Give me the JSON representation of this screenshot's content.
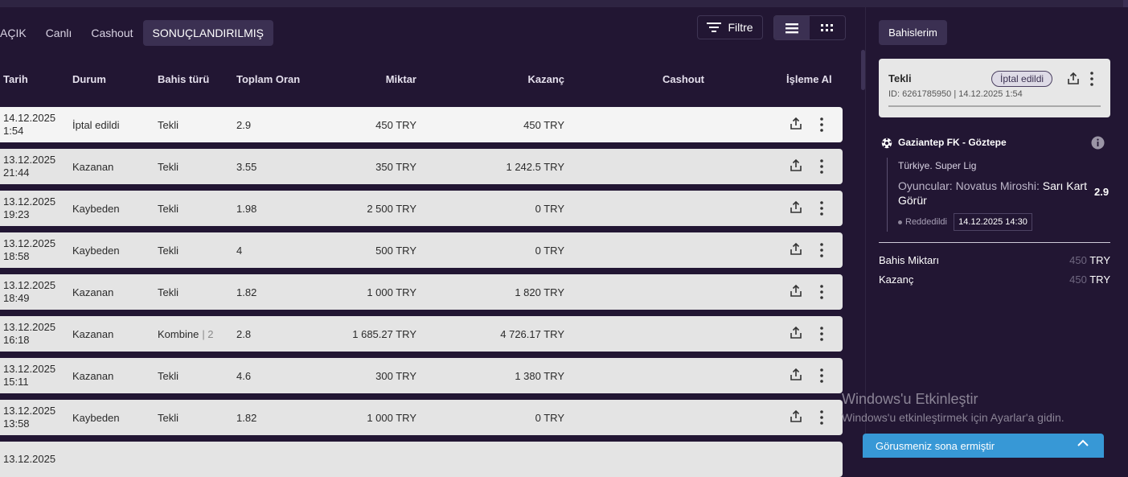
{
  "tabs": [
    {
      "label": "AÇIK"
    },
    {
      "label": "Canlı"
    },
    {
      "label": "Cashout"
    },
    {
      "label": "SONUÇLANDIRILMIŞ"
    }
  ],
  "toolbar": {
    "filter_label": "Filtre",
    "filter_icon": "filter-icon",
    "list_view_icon": "list-view-icon",
    "grid_view_icon": "grid-view-icon"
  },
  "columns": {
    "date": "Tarih",
    "status": "Durum",
    "type": "Bahis türü",
    "odds": "Toplam Oran",
    "amount": "Miktar",
    "win": "Kazanç",
    "cashout": "Cashout",
    "action": "İşleme Al"
  },
  "rows": [
    {
      "date": "14.12.2025",
      "time": "1:54",
      "status": "İptal edildi",
      "type": "Tekli",
      "count": "",
      "odds": "2.9",
      "amount": "450 TRY",
      "win": "450 TRY"
    },
    {
      "date": "13.12.2025",
      "time": "21:44",
      "status": "Kazanan",
      "type": "Tekli",
      "count": "",
      "odds": "3.55",
      "amount": "350 TRY",
      "win": "1 242.5 TRY"
    },
    {
      "date": "13.12.2025",
      "time": "19:23",
      "status": "Kaybeden",
      "type": "Tekli",
      "count": "",
      "odds": "1.98",
      "amount": "2 500 TRY",
      "win": "0 TRY"
    },
    {
      "date": "13.12.2025",
      "time": "18:58",
      "status": "Kaybeden",
      "type": "Tekli",
      "count": "",
      "odds": "4",
      "amount": "500 TRY",
      "win": "0 TRY"
    },
    {
      "date": "13.12.2025",
      "time": "18:49",
      "status": "Kazanan",
      "type": "Tekli",
      "count": "",
      "odds": "1.82",
      "amount": "1 000 TRY",
      "win": "1 820 TRY"
    },
    {
      "date": "13.12.2025",
      "time": "16:18",
      "status": "Kazanan",
      "type": "Kombine",
      "count": "| 2",
      "odds": "2.8",
      "amount": "1 685.27 TRY",
      "win": "4 726.17 TRY"
    },
    {
      "date": "13.12.2025",
      "time": "15:11",
      "status": "Kazanan",
      "type": "Tekli",
      "count": "",
      "odds": "4.6",
      "amount": "300 TRY",
      "win": "1 380 TRY"
    },
    {
      "date": "13.12.2025",
      "time": "13:58",
      "status": "Kaybeden",
      "type": "Tekli",
      "count": "",
      "odds": "1.82",
      "amount": "1 000 TRY",
      "win": "0 TRY"
    },
    {
      "date": "13.12.2025",
      "time": "",
      "status": "",
      "type": "",
      "count": "",
      "odds": "",
      "amount": "",
      "win": ""
    }
  ],
  "panel": {
    "tab_label": "Bahislerim",
    "card": {
      "title": "Tekli",
      "badge": "İptal edildi",
      "id_text": "ID: 6261785950  |  14.12.2025 1:54"
    },
    "match": "Gaziantep FK - Göztepe",
    "league": "Türkiye. Super Lig",
    "market_prefix": "Oyuncular: Novatus Miroshi:",
    "market_selection": "Sarı Kart Görür",
    "odd": "2.9",
    "status": "Reddedildi",
    "status_time": "14.12.2025 14:30",
    "stake_label": "Bahis Miktarı",
    "stake_value": "450",
    "stake_unit": "TRY",
    "win_label": "Kazanç",
    "win_value": "450",
    "win_unit": "TRY"
  },
  "watermark": {
    "title": "Windows'u Etkinleştir",
    "subtitle": "Windows'u etkinleştirmek için Ayarlar'a gidin."
  },
  "chat": {
    "label": "Görusmeniz sona ermiştir"
  }
}
